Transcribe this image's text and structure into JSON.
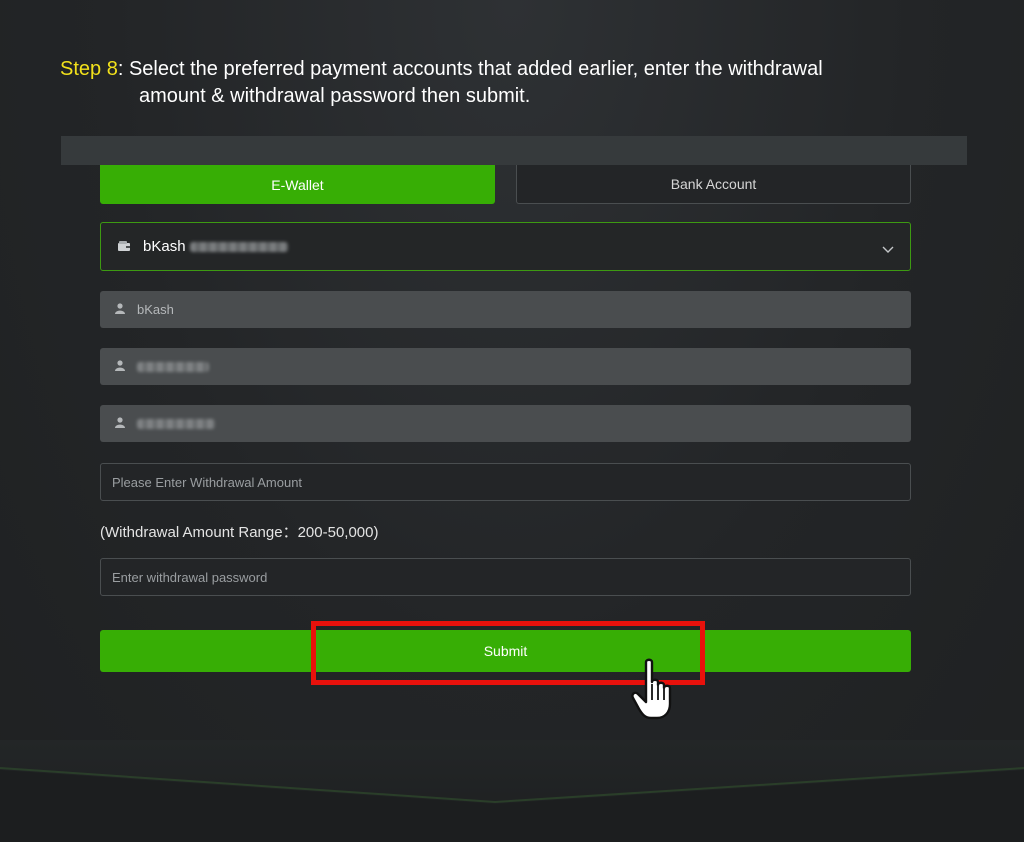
{
  "instruction": {
    "step_label": "Step 8",
    "line1": ": Select the preferred payment accounts that added earlier, enter the withdrawal",
    "line2": "amount & withdrawal password then submit."
  },
  "tabs": [
    {
      "label": "E-Wallet",
      "active": true
    },
    {
      "label": "Bank Account",
      "active": false
    }
  ],
  "account_select": {
    "selected_label": "bKash",
    "icon": "wallet-icon"
  },
  "account_details": {
    "provider": "bKash",
    "icon": "user-icon"
  },
  "withdrawal_amount": {
    "placeholder": "Please Enter Withdrawal Amount",
    "value": ""
  },
  "amount_range_text": "(Withdrawal Amount Range：200-50,000)",
  "withdrawal_password": {
    "placeholder": "Enter withdrawal password",
    "value": ""
  },
  "submit_label": "Submit",
  "colors": {
    "accent_green": "#37ae05",
    "step_yellow": "#f2e11b",
    "highlight_red": "#e8110c",
    "background": "#222426"
  }
}
